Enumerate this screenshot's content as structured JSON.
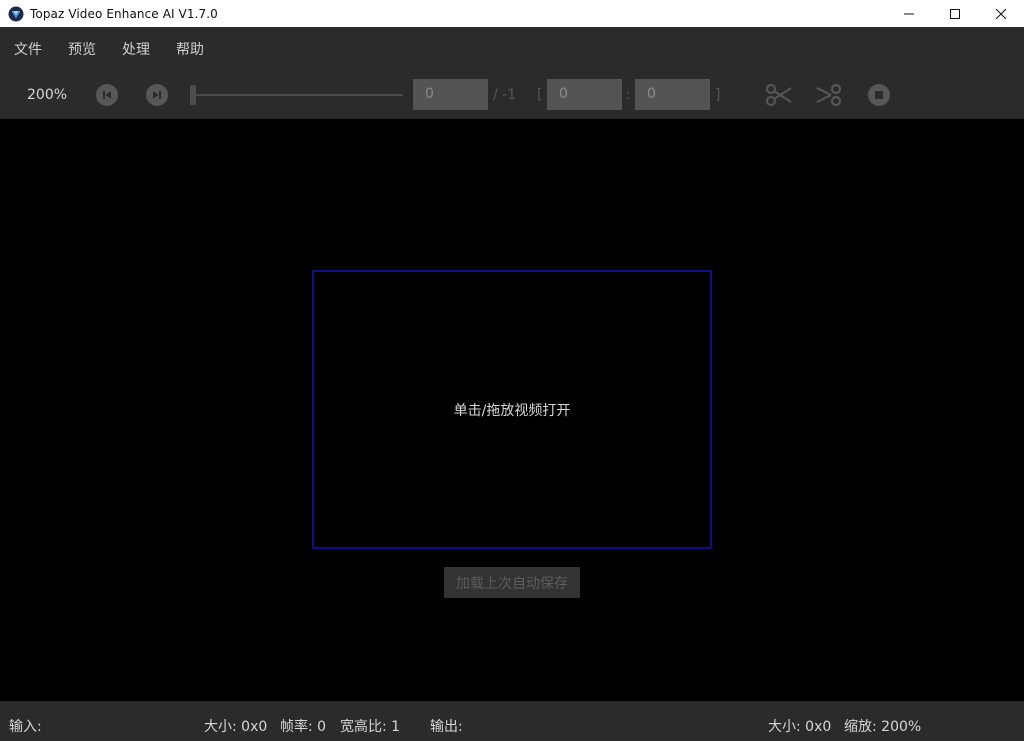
{
  "window": {
    "title": "Topaz Video Enhance AI V1.7.0"
  },
  "menu": {
    "items": [
      "文件",
      "预览",
      "处理",
      "帮助"
    ]
  },
  "toolbar": {
    "zoom": "200%",
    "frame_current": "0",
    "frame_total": "/ -1",
    "range_open": "[",
    "range_start": "0",
    "range_sep": ":",
    "range_end": "0",
    "range_close": "]"
  },
  "main": {
    "drop_text": "单击/拖放视频打开",
    "autosave_label": "加载上次自动保存"
  },
  "status": {
    "input_label": "输入:",
    "input_size": "大小: 0x0",
    "fps": "帧率: 0",
    "aspect": "宽高比: 1",
    "output_label": "输出:",
    "output_size": "大小: 0x0",
    "zoom": "缩放: 200%"
  },
  "colors": {
    "title_bg": "#ffffff",
    "chrome_bg": "#2b2b2b",
    "viewport_bg": "#000000",
    "drop_border": "#0f0f8a"
  },
  "icons": [
    "topaz-logo-icon",
    "minimize-icon",
    "maximize-icon",
    "close-icon",
    "skip-start-icon",
    "play-next-icon",
    "scissors-icon",
    "split-icon",
    "stop-icon"
  ]
}
